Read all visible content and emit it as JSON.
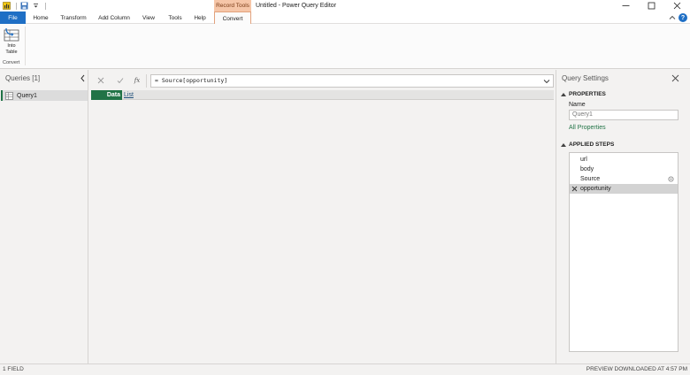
{
  "window": {
    "title": "Untitled - Power Query Editor",
    "context_tab_header": "Record Tools"
  },
  "ribbon": {
    "tabs": [
      "File",
      "Home",
      "Transform",
      "Add Column",
      "View",
      "Tools",
      "Help",
      "Convert"
    ],
    "active_tab": "Convert",
    "into_table_label": "Into\nTable",
    "group_label": "Convert"
  },
  "queries": {
    "header": "Queries [1]",
    "items": [
      {
        "label": "Query1"
      }
    ]
  },
  "formula": {
    "text": "= Source[opportunity]",
    "fx_label": "fx"
  },
  "grid": {
    "column_header": "Data",
    "value_link": "List"
  },
  "settings": {
    "title": "Query Settings",
    "properties_header": "PROPERTIES",
    "name_label": "Name",
    "name_value": "Query1",
    "all_properties": "All Properties",
    "applied_steps_header": "APPLIED STEPS",
    "steps": [
      {
        "label": "url"
      },
      {
        "label": "body"
      },
      {
        "label": "Source",
        "has_gear": true
      },
      {
        "label": "opportunity",
        "selected": true
      }
    ]
  },
  "status": {
    "left": "1 FIELD",
    "right": "PREVIEW DOWNLOADED AT 4:57 PM"
  },
  "colors": {
    "accent_green": "#217346",
    "file_blue": "#1f6fc5",
    "context_tab": "#f6c6a8"
  }
}
